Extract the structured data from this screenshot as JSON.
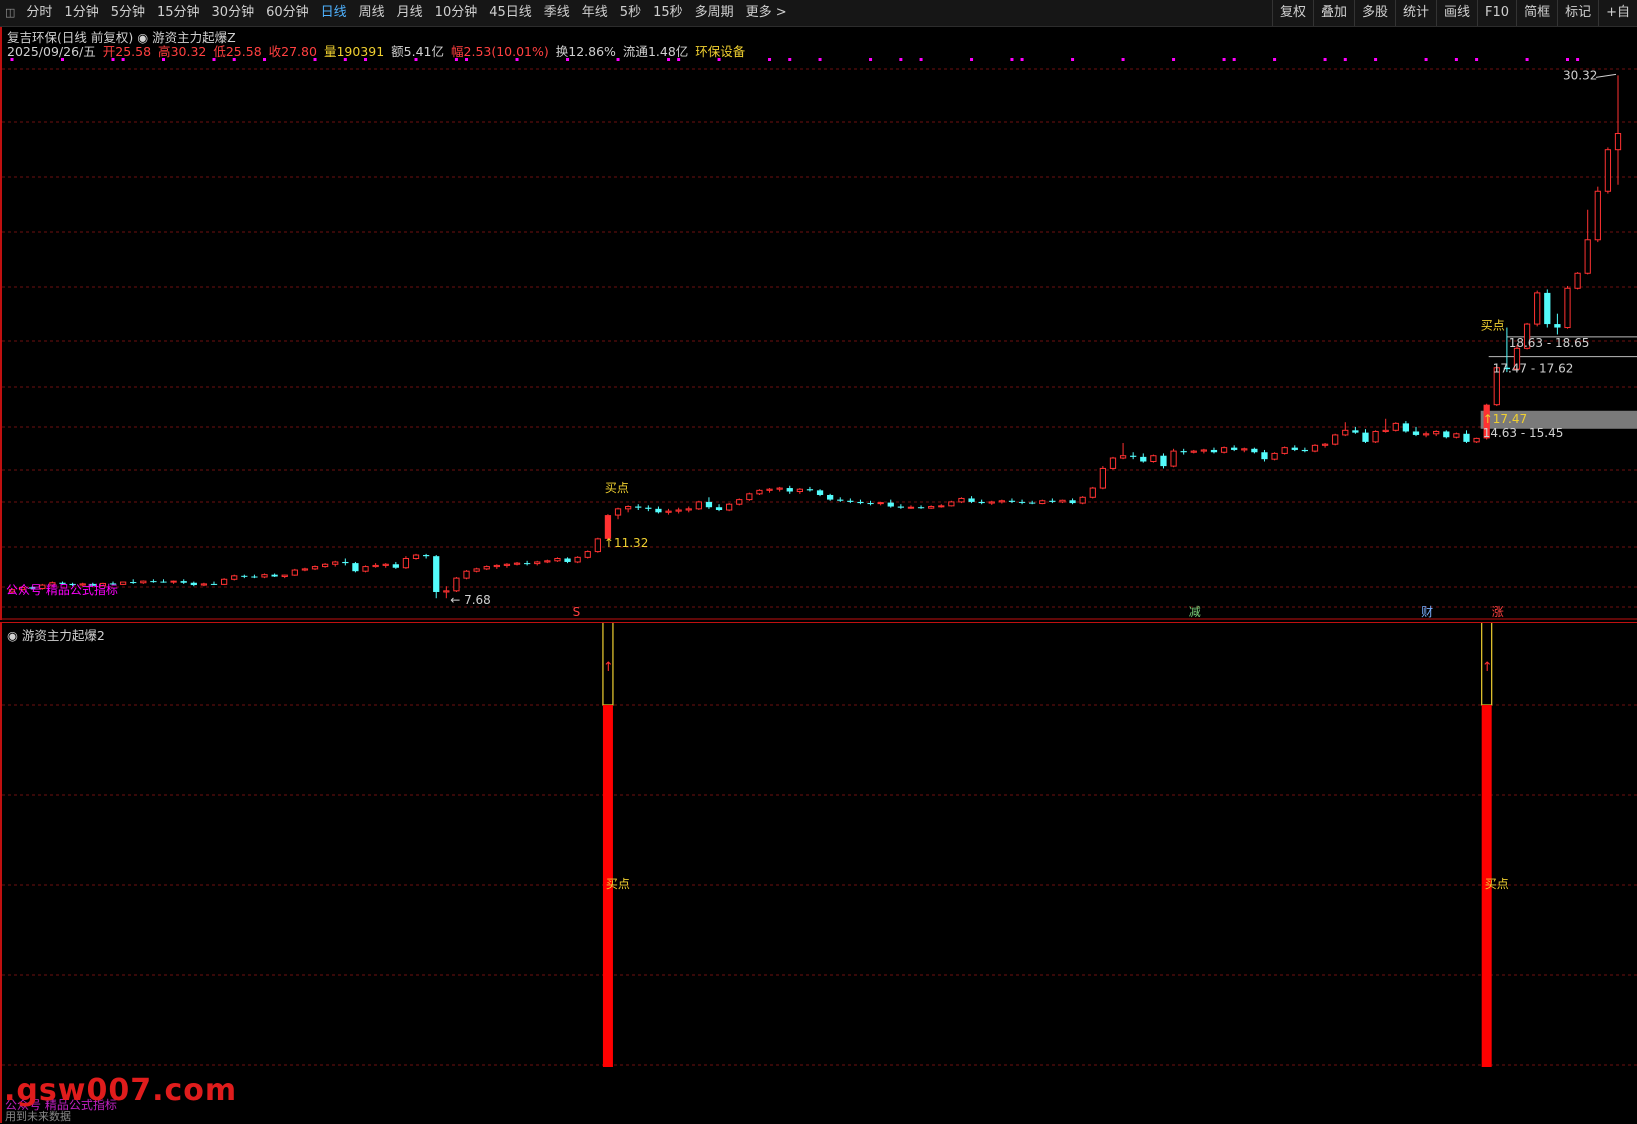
{
  "toolbar": {
    "period_tabs": [
      "分时",
      "1分钟",
      "5分钟",
      "15分钟",
      "30分钟",
      "60分钟",
      "日线",
      "周线",
      "月线",
      "10分钟",
      "45日线",
      "季线",
      "年线",
      "5秒",
      "15秒",
      "多周期",
      "更多 >"
    ],
    "active_tab": "日线",
    "tools": [
      "复权",
      "叠加",
      "多股",
      "统计",
      "画线",
      "F10",
      "简框",
      "标记",
      "+自"
    ]
  },
  "stock": {
    "name_line": "复吉环保(日线 前复权)",
    "indicator": "游资主力起爆Z",
    "date": "2025/09/26/五",
    "open_label": "开",
    "open": "25.58",
    "high_label": "高",
    "high": "30.32",
    "low_label": "低",
    "low": "25.58",
    "close_label": "收",
    "close": "27.80",
    "vol_label": "量",
    "vol": "190391",
    "amount_label": "额",
    "amount": "5.41亿",
    "change_label": "幅",
    "change": "2.53(10.01%)",
    "turnover_label": "换",
    "turnover": "12.86%",
    "float_label": "流通",
    "float": "1.48亿",
    "sector": "环保设备"
  },
  "colors": {
    "up": "#ff3232",
    "down": "#54fcfc",
    "grid": "#6e1010",
    "magenta": "#ff00ff",
    "yellow": "#f0d030"
  },
  "chart_data": {
    "type": "candlestick",
    "ohlc": [
      [
        7.95,
        8.1,
        7.9,
        8.05
      ],
      [
        8.05,
        8.2,
        7.98,
        8.15
      ],
      [
        8.15,
        8.2,
        8.05,
        8.1
      ],
      [
        8.1,
        8.3,
        8.05,
        8.25
      ],
      [
        8.25,
        8.4,
        8.2,
        8.35
      ],
      [
        8.35,
        8.4,
        8.25,
        8.3
      ],
      [
        8.3,
        8.35,
        8.2,
        8.25
      ],
      [
        8.25,
        8.35,
        8.2,
        8.3
      ],
      [
        8.3,
        8.35,
        8.2,
        8.22
      ],
      [
        8.22,
        8.35,
        8.2,
        8.32
      ],
      [
        8.32,
        8.4,
        8.25,
        8.28
      ],
      [
        8.28,
        8.4,
        8.25,
        8.38
      ],
      [
        8.38,
        8.5,
        8.3,
        8.35
      ],
      [
        8.35,
        8.45,
        8.3,
        8.42
      ],
      [
        8.42,
        8.5,
        8.35,
        8.4
      ],
      [
        8.4,
        8.5,
        8.35,
        8.38
      ],
      [
        8.38,
        8.45,
        8.3,
        8.42
      ],
      [
        8.42,
        8.5,
        8.3,
        8.35
      ],
      [
        8.35,
        8.4,
        8.2,
        8.25
      ],
      [
        8.25,
        8.35,
        8.2,
        8.3
      ],
      [
        8.3,
        8.4,
        8.25,
        8.28
      ],
      [
        8.28,
        8.55,
        8.25,
        8.5
      ],
      [
        8.5,
        8.7,
        8.45,
        8.65
      ],
      [
        8.65,
        8.7,
        8.55,
        8.62
      ],
      [
        8.62,
        8.7,
        8.55,
        8.6
      ],
      [
        8.6,
        8.75,
        8.55,
        8.7
      ],
      [
        8.7,
        8.75,
        8.6,
        8.62
      ],
      [
        8.62,
        8.7,
        8.55,
        8.68
      ],
      [
        8.68,
        8.95,
        8.65,
        8.9
      ],
      [
        8.9,
        9.0,
        8.85,
        8.95
      ],
      [
        8.95,
        9.1,
        8.9,
        9.05
      ],
      [
        9.05,
        9.2,
        9.0,
        9.15
      ],
      [
        9.15,
        9.3,
        9.05,
        9.25
      ],
      [
        9.25,
        9.4,
        9.1,
        9.2
      ],
      [
        9.2,
        9.25,
        8.8,
        8.85
      ],
      [
        8.85,
        9.1,
        8.8,
        9.05
      ],
      [
        9.05,
        9.2,
        9.0,
        9.1
      ],
      [
        9.1,
        9.2,
        9.0,
        9.15
      ],
      [
        9.15,
        9.25,
        8.95,
        9.0
      ],
      [
        9.0,
        9.5,
        8.95,
        9.4
      ],
      [
        9.4,
        9.6,
        9.35,
        9.55
      ],
      [
        9.55,
        9.6,
        9.4,
        9.5
      ],
      [
        9.5,
        9.55,
        7.68,
        7.95
      ],
      [
        7.95,
        8.2,
        7.68,
        8.0
      ],
      [
        8.0,
        8.6,
        7.95,
        8.55
      ],
      [
        8.55,
        8.9,
        8.5,
        8.85
      ],
      [
        8.85,
        9.0,
        8.8,
        8.95
      ],
      [
        8.95,
        9.1,
        8.9,
        9.05
      ],
      [
        9.05,
        9.15,
        8.95,
        9.1
      ],
      [
        9.1,
        9.2,
        9.0,
        9.15
      ],
      [
        9.15,
        9.25,
        9.1,
        9.2
      ],
      [
        9.2,
        9.3,
        9.1,
        9.18
      ],
      [
        9.18,
        9.3,
        9.1,
        9.25
      ],
      [
        9.25,
        9.35,
        9.2,
        9.3
      ],
      [
        9.3,
        9.45,
        9.25,
        9.4
      ],
      [
        9.4,
        9.45,
        9.2,
        9.25
      ],
      [
        9.25,
        9.5,
        9.2,
        9.45
      ],
      [
        9.45,
        9.75,
        9.4,
        9.7
      ],
      [
        9.7,
        10.3,
        9.65,
        10.25
      ],
      [
        10.25,
        11.32,
        10.2,
        11.28
      ],
      [
        11.28,
        11.6,
        11.1,
        11.55
      ],
      [
        11.55,
        11.7,
        11.4,
        11.65
      ],
      [
        11.65,
        11.75,
        11.5,
        11.6
      ],
      [
        11.6,
        11.7,
        11.45,
        11.55
      ],
      [
        11.55,
        11.65,
        11.35,
        11.4
      ],
      [
        11.4,
        11.55,
        11.3,
        11.45
      ],
      [
        11.45,
        11.6,
        11.35,
        11.5
      ],
      [
        11.5,
        11.65,
        11.4,
        11.55
      ],
      [
        11.55,
        11.9,
        11.5,
        11.85
      ],
      [
        11.85,
        12.05,
        11.55,
        11.62
      ],
      [
        11.62,
        11.75,
        11.45,
        11.5
      ],
      [
        11.5,
        11.8,
        11.45,
        11.75
      ],
      [
        11.75,
        12.0,
        11.7,
        11.95
      ],
      [
        11.95,
        12.25,
        11.9,
        12.2
      ],
      [
        12.2,
        12.4,
        12.15,
        12.35
      ],
      [
        12.35,
        12.45,
        12.25,
        12.4
      ],
      [
        12.4,
        12.5,
        12.3,
        12.45
      ],
      [
        12.45,
        12.55,
        12.2,
        12.3
      ],
      [
        12.3,
        12.45,
        12.2,
        12.4
      ],
      [
        12.4,
        12.5,
        12.3,
        12.35
      ],
      [
        12.35,
        12.4,
        12.1,
        12.15
      ],
      [
        12.15,
        12.2,
        11.9,
        11.95
      ],
      [
        11.95,
        12.05,
        11.85,
        11.9
      ],
      [
        11.9,
        12.0,
        11.8,
        11.85
      ],
      [
        11.85,
        11.95,
        11.75,
        11.8
      ],
      [
        11.8,
        11.9,
        11.7,
        11.78
      ],
      [
        11.78,
        11.85,
        11.7,
        11.82
      ],
      [
        11.82,
        11.95,
        11.6,
        11.65
      ],
      [
        11.65,
        11.75,
        11.55,
        11.6
      ],
      [
        11.6,
        11.7,
        11.55,
        11.62
      ],
      [
        11.62,
        11.7,
        11.55,
        11.58
      ],
      [
        11.58,
        11.7,
        11.55,
        11.65
      ],
      [
        11.65,
        11.75,
        11.6,
        11.68
      ],
      [
        11.68,
        11.9,
        11.65,
        11.85
      ],
      [
        11.85,
        12.05,
        11.8,
        12.0
      ],
      [
        12.0,
        12.1,
        11.8,
        11.85
      ],
      [
        11.85,
        11.95,
        11.75,
        11.8
      ],
      [
        11.8,
        11.9,
        11.72,
        11.85
      ],
      [
        11.85,
        11.95,
        11.78,
        11.9
      ],
      [
        11.9,
        12.0,
        11.8,
        11.85
      ],
      [
        11.85,
        11.95,
        11.75,
        11.82
      ],
      [
        11.82,
        11.9,
        11.75,
        11.78
      ],
      [
        11.78,
        11.95,
        11.75,
        11.9
      ],
      [
        11.9,
        12.0,
        11.8,
        11.85
      ],
      [
        11.85,
        11.95,
        11.8,
        11.92
      ],
      [
        11.92,
        12.0,
        11.75,
        11.8
      ],
      [
        11.8,
        12.1,
        11.75,
        12.05
      ],
      [
        12.05,
        12.5,
        12.0,
        12.45
      ],
      [
        12.45,
        13.4,
        12.4,
        13.3
      ],
      [
        13.3,
        13.8,
        13.25,
        13.75
      ],
      [
        13.75,
        14.4,
        13.7,
        13.85
      ],
      [
        13.85,
        14.0,
        13.7,
        13.8
      ],
      [
        13.8,
        13.95,
        13.55,
        13.6
      ],
      [
        13.6,
        13.9,
        13.55,
        13.85
      ],
      [
        13.85,
        13.95,
        13.3,
        13.4
      ],
      [
        13.4,
        14.15,
        13.35,
        14.05
      ],
      [
        14.05,
        14.15,
        13.9,
        14.0
      ],
      [
        14.0,
        14.1,
        13.95,
        14.05
      ],
      [
        14.05,
        14.15,
        13.95,
        14.1
      ],
      [
        14.1,
        14.2,
        13.95,
        14.0
      ],
      [
        14.0,
        14.25,
        13.95,
        14.2
      ],
      [
        14.2,
        14.3,
        14.05,
        14.1
      ],
      [
        14.1,
        14.2,
        14.0,
        14.15
      ],
      [
        14.15,
        14.2,
        13.95,
        14.0
      ],
      [
        14.0,
        14.1,
        13.6,
        13.7
      ],
      [
        13.7,
        14.0,
        13.65,
        13.95
      ],
      [
        13.95,
        14.25,
        13.9,
        14.2
      ],
      [
        14.2,
        14.3,
        14.05,
        14.1
      ],
      [
        14.1,
        14.2,
        14.0,
        14.05
      ],
      [
        14.05,
        14.35,
        14.0,
        14.3
      ],
      [
        14.3,
        14.4,
        14.2,
        14.35
      ],
      [
        14.35,
        14.8,
        14.3,
        14.75
      ],
      [
        14.75,
        15.3,
        14.7,
        14.95
      ],
      [
        14.95,
        15.1,
        14.8,
        14.85
      ],
      [
        14.85,
        15.0,
        14.4,
        14.45
      ],
      [
        14.45,
        14.95,
        14.4,
        14.9
      ],
      [
        14.9,
        15.45,
        14.85,
        14.95
      ],
      [
        14.95,
        15.3,
        14.9,
        15.25
      ],
      [
        15.25,
        15.35,
        14.85,
        14.9
      ],
      [
        14.9,
        15.1,
        14.7,
        14.75
      ],
      [
        14.75,
        14.9,
        14.65,
        14.8
      ],
      [
        14.8,
        14.95,
        14.7,
        14.9
      ],
      [
        14.9,
        14.95,
        14.6,
        14.65
      ],
      [
        14.65,
        14.85,
        14.6,
        14.8
      ],
      [
        14.8,
        14.95,
        14.4,
        14.45
      ],
      [
        14.45,
        14.63,
        14.4,
        14.6
      ],
      [
        14.6,
        16.1,
        14.55,
        16.06
      ],
      [
        16.06,
        17.7,
        16.0,
        17.66
      ],
      [
        17.66,
        19.4,
        17.47,
        17.6
      ],
      [
        17.6,
        18.65,
        17.55,
        18.5
      ],
      [
        18.5,
        19.6,
        18.45,
        19.55
      ],
      [
        19.55,
        21.0,
        19.45,
        20.9
      ],
      [
        20.9,
        21.05,
        19.4,
        19.55
      ],
      [
        19.55,
        20.0,
        19.1,
        19.4
      ],
      [
        19.4,
        21.2,
        19.35,
        21.1
      ],
      [
        21.1,
        21.8,
        21.05,
        21.75
      ],
      [
        21.75,
        24.5,
        21.7,
        23.2
      ],
      [
        23.2,
        25.5,
        23.1,
        25.3
      ],
      [
        25.3,
        27.2,
        25.2,
        27.1
      ],
      [
        27.1,
        30.32,
        25.58,
        27.8
      ]
    ],
    "signals": [
      59,
      146
    ],
    "ylim": [
      7.3,
      31.2
    ],
    "sub": {
      "type": "bar",
      "label": "买点"
    }
  },
  "annotations": {
    "high_label": "30.32",
    "low_label": "← 7.68",
    "low_arrow": "←",
    "low_value": "7.68",
    "buy_label": "买点",
    "signal1_price": "11.32",
    "signal2_price": "17.47",
    "range1": "18.63 - 18.65",
    "range2": "17.47 - 17.62",
    "range3": "14.63 - 15.45",
    "brand": "公众号 精品公式指标",
    "markers": [
      "S",
      "减",
      "财",
      "涨"
    ]
  },
  "sub_panel": {
    "title": "游资主力起爆2"
  },
  "footer": {
    "watermark": ".gsw007.com",
    "note": "用到未来数据",
    "brand": "公众号 精品公式指标"
  }
}
